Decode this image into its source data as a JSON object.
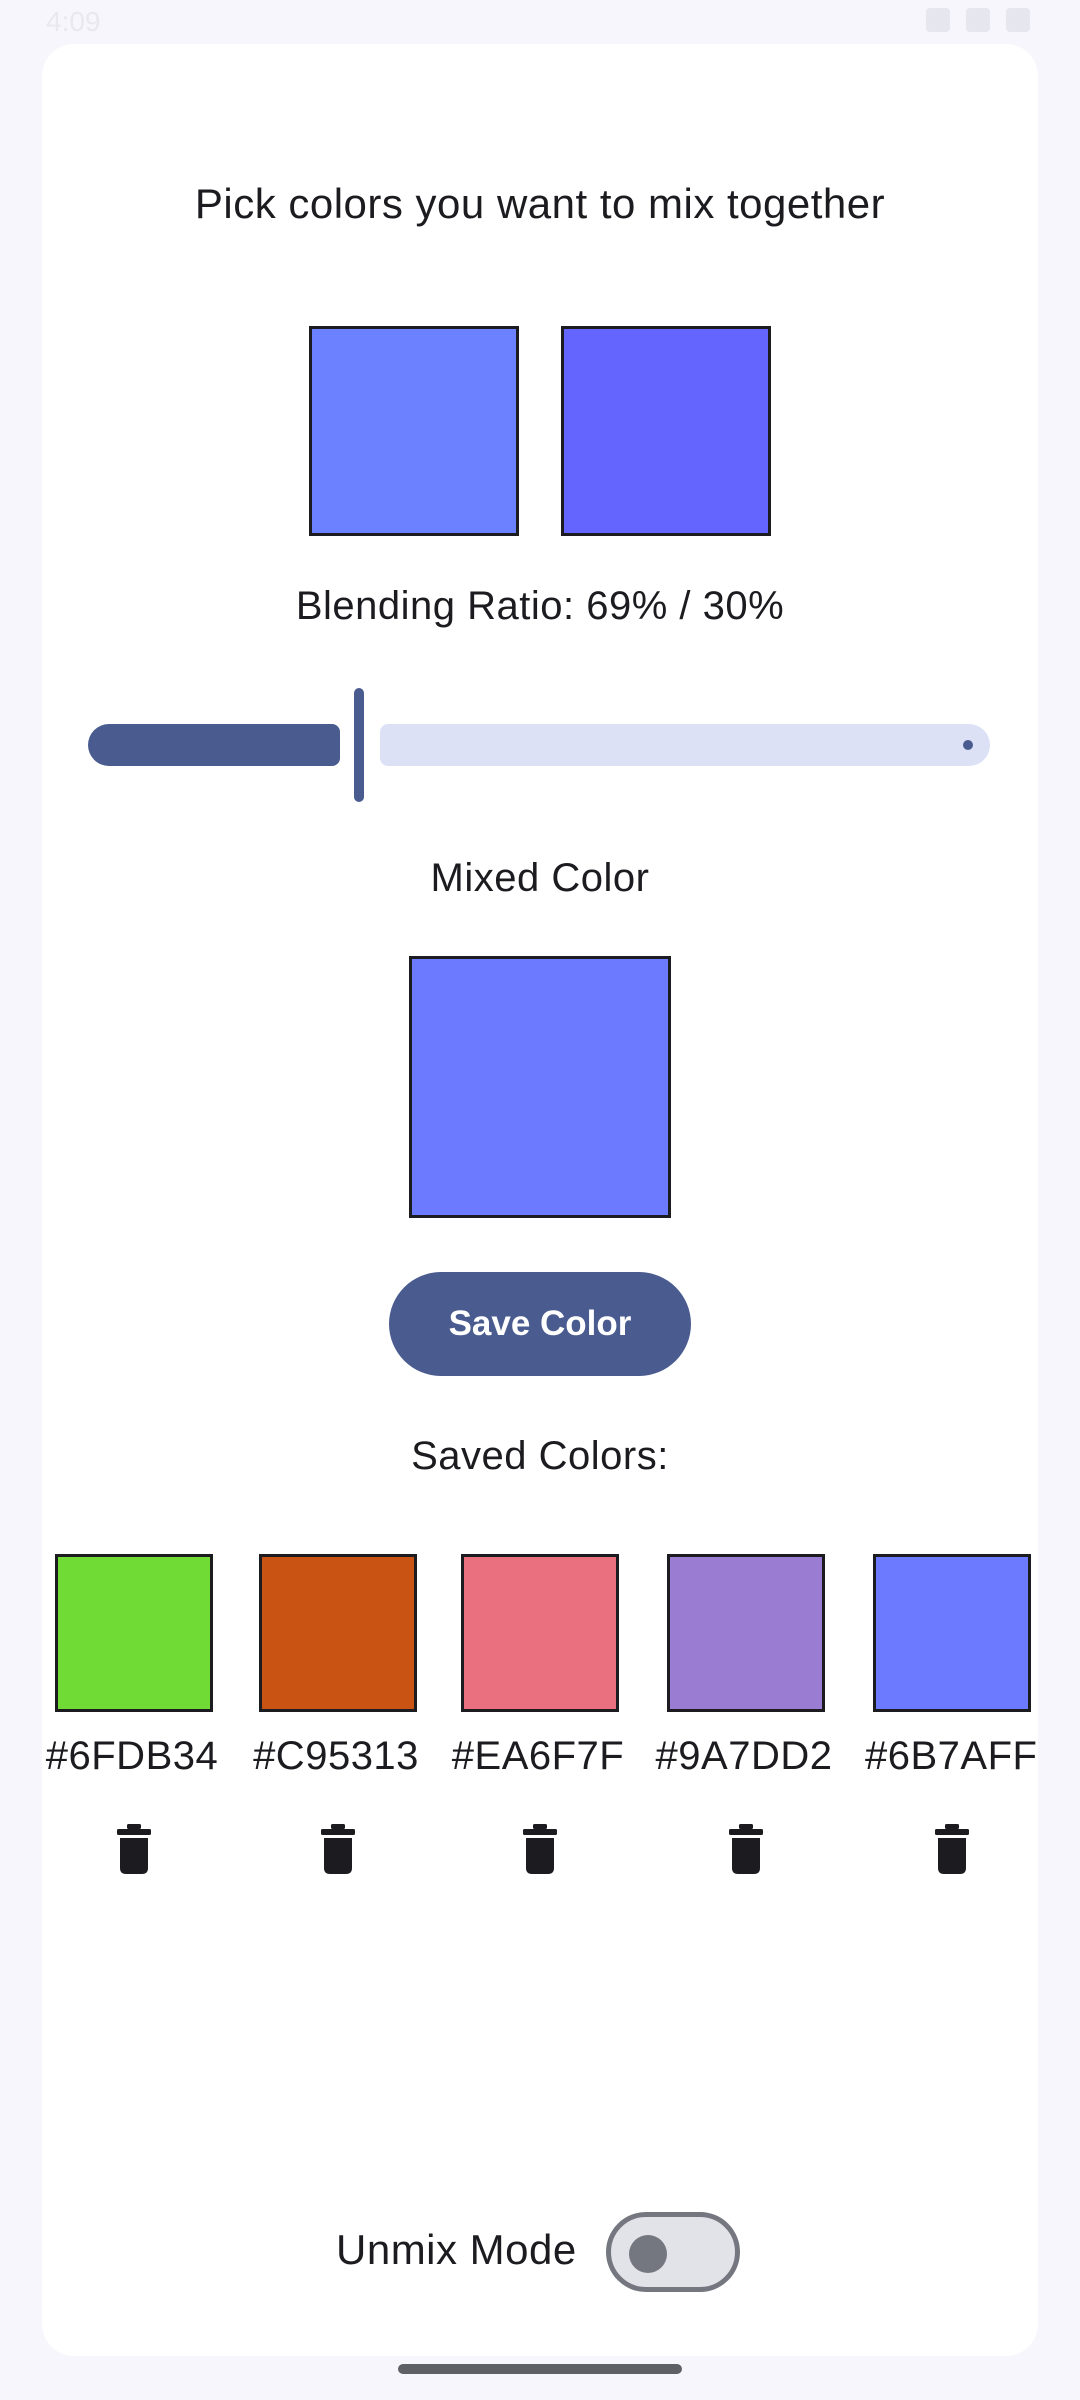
{
  "status_bar": {
    "time": "4:09"
  },
  "picker": {
    "title": "Pick colors you want to mix together",
    "color1": "#6B81FF",
    "color2": "#6464FF"
  },
  "blend": {
    "label": "Blending Ratio: 69% / 30%",
    "slider_fraction": 0.3
  },
  "mixed": {
    "label": "Mixed Color",
    "color": "#6B7AFF"
  },
  "save_button": {
    "label": "Save Color"
  },
  "saved": {
    "label": "Saved Colors:",
    "items": [
      {
        "hex": "#6FDB34",
        "color": "#6FDB34"
      },
      {
        "hex": "#C95313",
        "color": "#C95313"
      },
      {
        "hex": "#EA6F7F",
        "color": "#EA6F7F"
      },
      {
        "hex": "#9A7DD2",
        "color": "#9A7DD2"
      },
      {
        "hex": "#6B7AFF",
        "color": "#6B7AFF"
      }
    ]
  },
  "unmix": {
    "label": "Unmix Mode",
    "enabled": false
  },
  "icons": {
    "delete": "trash-icon"
  },
  "colors": {
    "accent": "#4A5B8F",
    "slider_track": "#DDE1F6"
  }
}
